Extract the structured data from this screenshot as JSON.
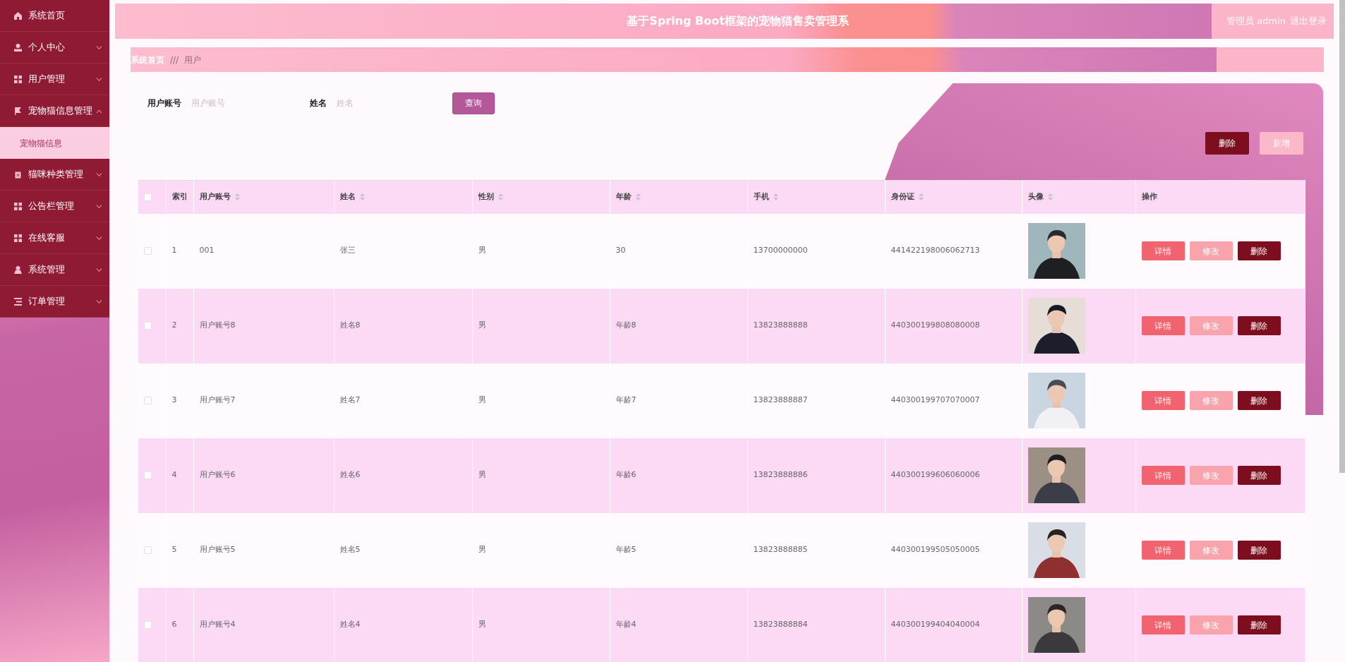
{
  "sidebar": {
    "items": [
      {
        "label": "系统首页",
        "kind": "link"
      },
      {
        "label": "个人中心",
        "kind": "menu",
        "expanded": false
      },
      {
        "label": "用户管理",
        "kind": "menu",
        "expanded": false
      },
      {
        "label": "宠物猫信息管理",
        "kind": "menu",
        "expanded": true,
        "children": [
          {
            "label": "宠物猫信息",
            "hovered": true
          }
        ]
      },
      {
        "label": "猫咪种类管理",
        "kind": "menu",
        "expanded": false
      },
      {
        "label": "公告栏管理",
        "kind": "menu",
        "expanded": false
      },
      {
        "label": "在线客服",
        "kind": "menu",
        "expanded": false
      },
      {
        "label": "系统管理",
        "kind": "menu",
        "expanded": false
      },
      {
        "label": "订单管理",
        "kind": "menu",
        "expanded": false
      }
    ]
  },
  "header": {
    "title": "基于Spring Boot框架的宠物猫售卖管理系",
    "user": "管理员 admin",
    "logout": "退出登录"
  },
  "breadcrumb": {
    "home": "系统首页",
    "separator": "///",
    "current": "用户"
  },
  "filters": [
    {
      "label": "用户账号",
      "placeholder": "用户账号"
    },
    {
      "label": "姓名",
      "placeholder": "姓名"
    }
  ],
  "search_button": "查询",
  "toolbar": {
    "delete": "删除",
    "add": "新增"
  },
  "table": {
    "all_checked": false,
    "columns": [
      {
        "label": "索引",
        "sortable": false
      },
      {
        "label": "用户账号",
        "sortable": true
      },
      {
        "label": "姓名",
        "sortable": true
      },
      {
        "label": "性别",
        "sortable": true
      },
      {
        "label": "年龄",
        "sortable": true
      },
      {
        "label": "手机",
        "sortable": true
      },
      {
        "label": "身份证",
        "sortable": true
      },
      {
        "label": "头像",
        "sortable": true
      },
      {
        "label": "操作",
        "sortable": false
      }
    ],
    "rows": [
      {
        "checked": false,
        "index": "1",
        "account": "001",
        "name": "张三",
        "sex": "男",
        "age": "30",
        "phone": "13700000000",
        "id_card": "441422198006062713",
        "actions": [
          "详情",
          "修改",
          "删除"
        ]
      },
      {
        "checked": false,
        "index": "2",
        "account": "用户账号8",
        "name": "姓名8",
        "sex": "男",
        "age": "年龄8",
        "phone": "13823888888",
        "id_card": "440300199808080008",
        "actions": [
          "详情",
          "修改",
          "删除"
        ]
      },
      {
        "checked": false,
        "index": "3",
        "account": "用户账号7",
        "name": "姓名7",
        "sex": "男",
        "age": "年龄7",
        "phone": "13823888887",
        "id_card": "440300199707070007",
        "actions": [
          "详情",
          "修改",
          "删除"
        ]
      },
      {
        "checked": false,
        "index": "4",
        "account": "用户账号6",
        "name": "姓名6",
        "sex": "男",
        "age": "年龄6",
        "phone": "13823888886",
        "id_card": "440300199606060006",
        "actions": [
          "详情",
          "修改",
          "删除"
        ]
      },
      {
        "checked": false,
        "index": "5",
        "account": "用户账号5",
        "name": "姓名5",
        "sex": "男",
        "age": "年龄5",
        "phone": "13823888885",
        "id_card": "440300199505050005",
        "actions": [
          "详情",
          "修改",
          "删除"
        ]
      },
      {
        "checked": false,
        "index": "6",
        "account": "用户账号4",
        "name": "姓名4",
        "sex": "男",
        "age": "年龄4",
        "phone": "13823888884",
        "id_card": "440300199404040004",
        "actions": [
          "详情",
          "修改",
          "删除"
        ]
      }
    ]
  }
}
